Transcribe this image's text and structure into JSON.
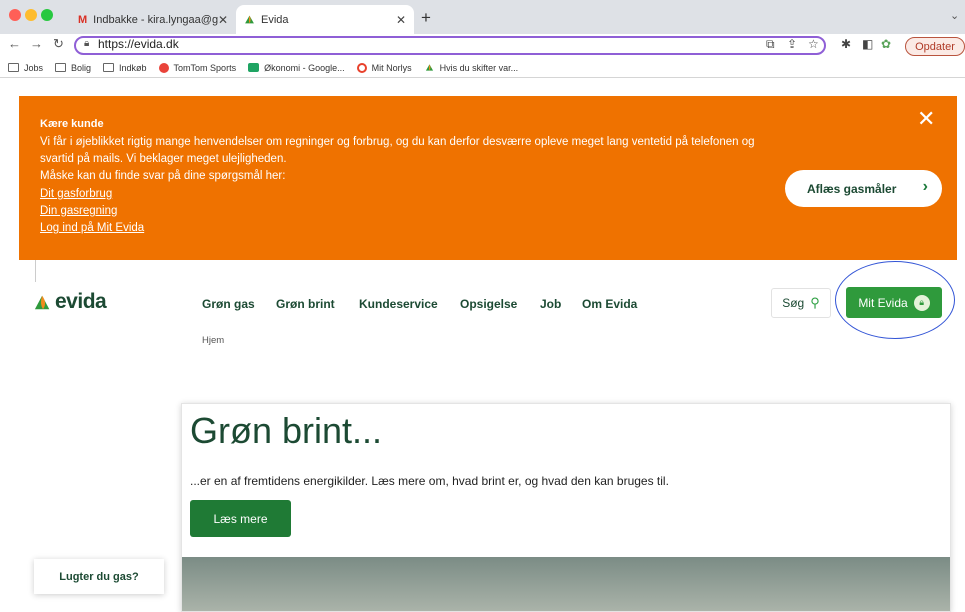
{
  "browser": {
    "tabs": [
      {
        "title": "Indbakke - kira.lyngaa@gmail.c",
        "icon": "gmail-icon"
      },
      {
        "title": "Evida",
        "icon": "evida-flame-icon"
      }
    ],
    "new_tab": "+",
    "url": "https://evida.dk",
    "update_label": "Opdater",
    "bookmarks": [
      {
        "label": "Jobs",
        "icon": "folder-icon"
      },
      {
        "label": "Bolig",
        "icon": "folder-icon"
      },
      {
        "label": "Indkøb",
        "icon": "folder-icon"
      },
      {
        "label": "TomTom Sports",
        "icon": "tomtom-icon"
      },
      {
        "label": "Økonomi - Google...",
        "icon": "sheets-icon"
      },
      {
        "label": "Mit Norlys",
        "icon": "norlys-icon"
      },
      {
        "label": "Hvis du skifter var...",
        "icon": "evida-flame-icon"
      }
    ]
  },
  "banner": {
    "title": "Kære kunde",
    "message": "Vi får i øjeblikket rigtig mange henvendelser om regninger og forbrug, og du kan derfor desværre opleve meget lang ventetid på telefonen og svartid på mails. Vi beklager meget ulejligheden.",
    "hint": "Måske kan du finde svar på dine spørgsmål her:",
    "links": [
      "Dit gasforbrug",
      "Din gasregning",
      "Log ind på Mit Evida"
    ],
    "cta_label": "Aflæs gasmåler",
    "background": "#ef7200"
  },
  "header": {
    "logo_text": "evida",
    "nav": [
      "Grøn gas",
      "Grøn brint",
      "Kundeservice",
      "Opsigelse",
      "Job",
      "Om Evida"
    ],
    "search_label": "Søg",
    "mit_evida_label": "Mit Evida",
    "accent": "#2f9a3c"
  },
  "breadcrumb": "Hjem",
  "hero": {
    "title": "Grøn brint...",
    "subtitle": "...er en af fremtidens energikilder. Læs mere om, hvad brint er, og hvad den kan bruges til.",
    "button_label": "Læs mere"
  },
  "gas_smell_label": "Lugter du gas?"
}
